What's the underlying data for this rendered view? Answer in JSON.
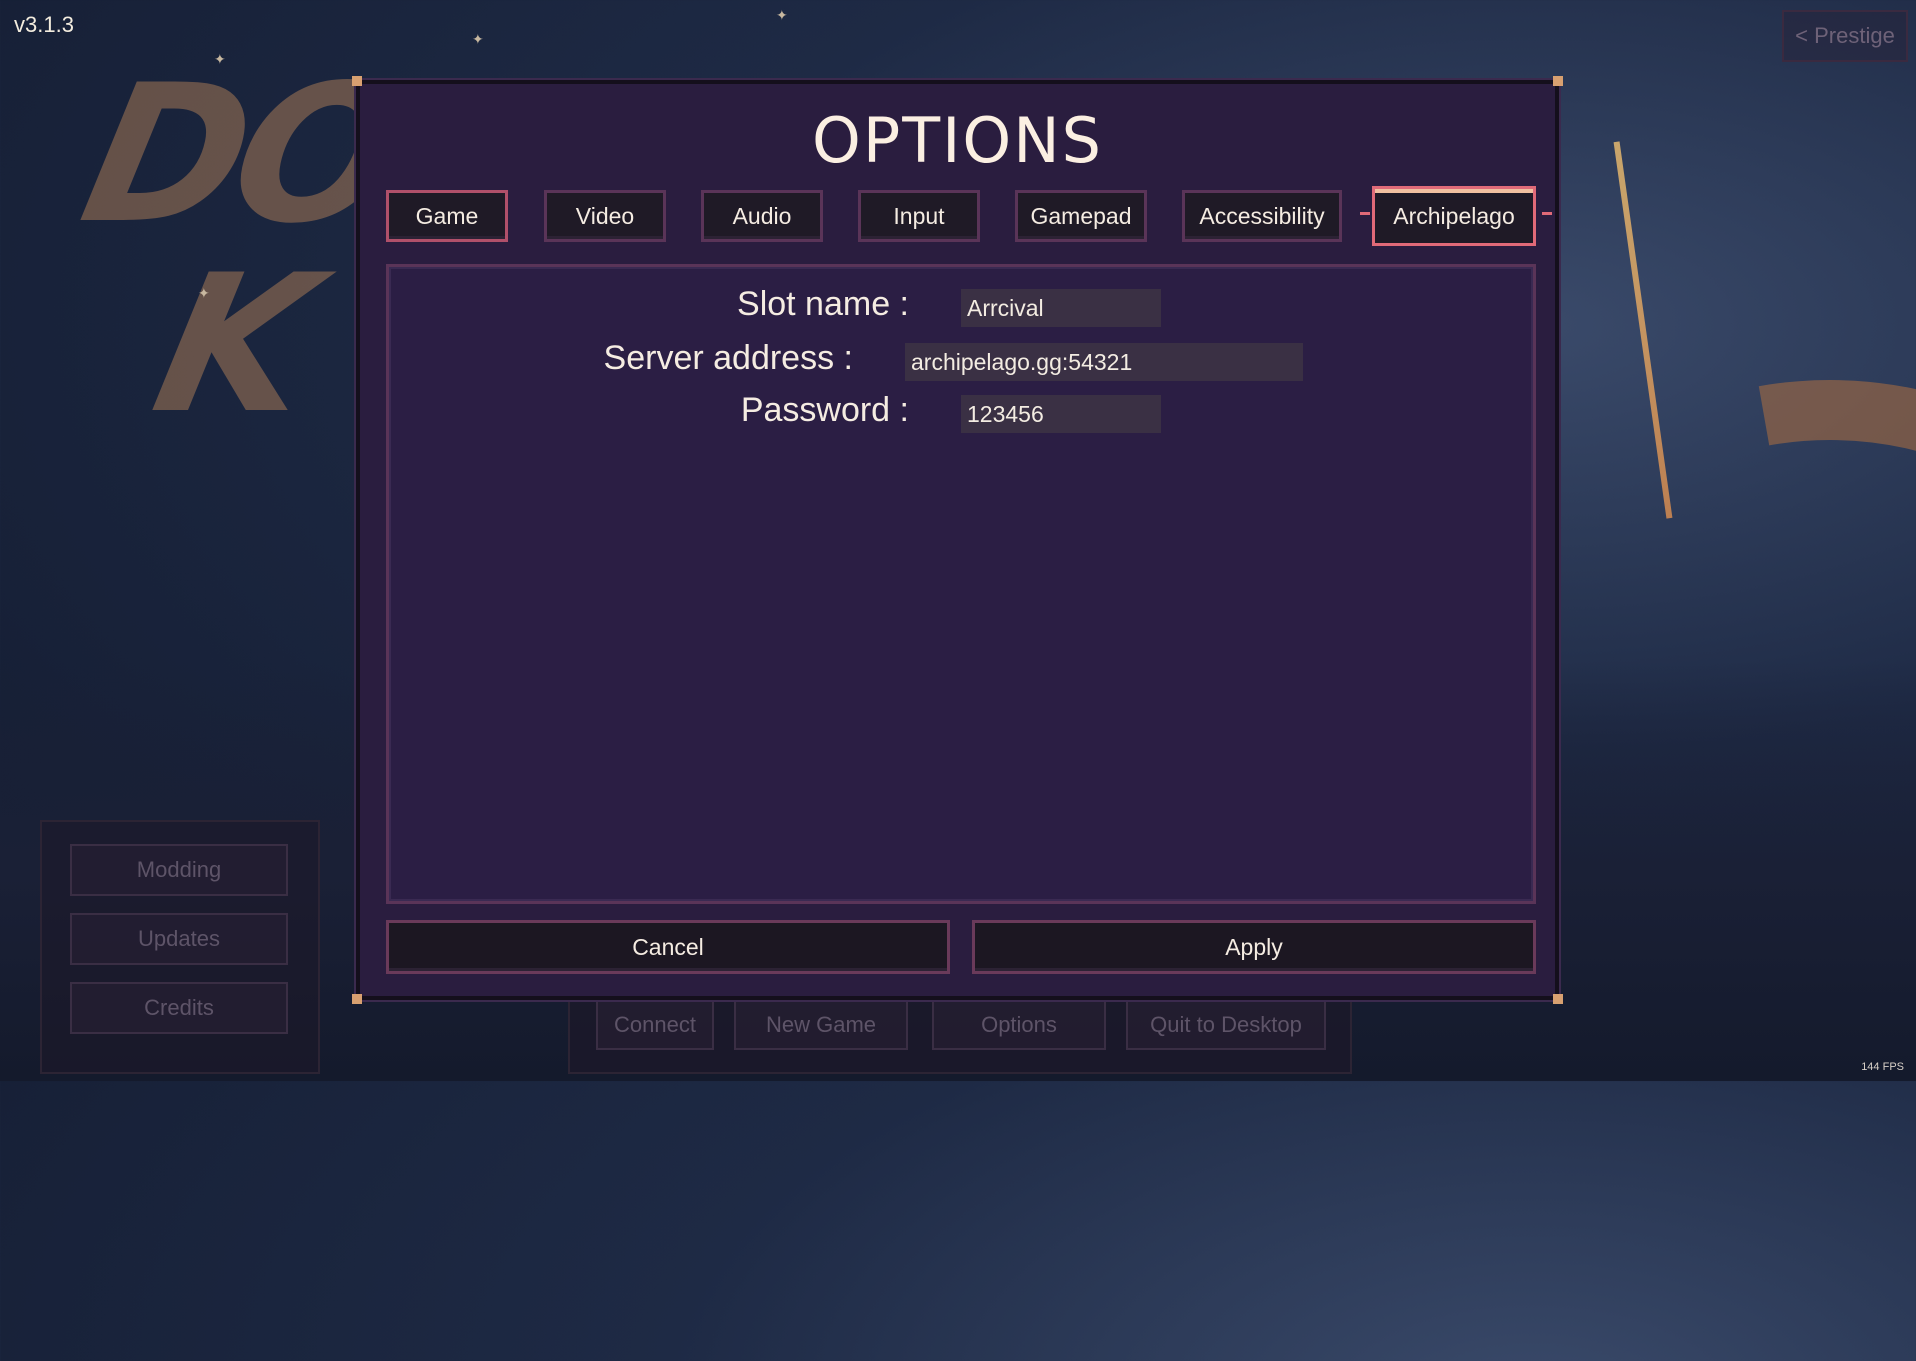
{
  "version": "v3.1.3",
  "prestige_label": "< Prestige",
  "fps": "144 FPS",
  "side_menu": {
    "items": [
      {
        "label": "Modding"
      },
      {
        "label": "Updates"
      },
      {
        "label": "Credits"
      }
    ]
  },
  "bottom_menu": {
    "items": [
      {
        "label": "Connect"
      },
      {
        "label": "New Game"
      },
      {
        "label": "Options"
      },
      {
        "label": "Quit to Desktop"
      }
    ]
  },
  "dialog": {
    "title": "OPTIONS",
    "tabs": [
      {
        "label": "Game"
      },
      {
        "label": "Video"
      },
      {
        "label": "Audio"
      },
      {
        "label": "Input"
      },
      {
        "label": "Gamepad"
      },
      {
        "label": "Accessibility"
      },
      {
        "label": "Archipelago"
      }
    ],
    "selected_tab": "Archipelago",
    "fields": {
      "slot_name": {
        "label": "Slot name :",
        "value": "Arrcival"
      },
      "server_address": {
        "label": "Server address :",
        "value": "archipelago.gg:54321"
      },
      "password": {
        "label": "Password :",
        "value": "123456"
      }
    },
    "cancel_label": "Cancel",
    "apply_label": "Apply"
  },
  "colors": {
    "dialog_bg": "#2a1d3f",
    "tab_border": "#5a3458",
    "selected_border": "#e06a78",
    "text": "#f5ece2"
  }
}
